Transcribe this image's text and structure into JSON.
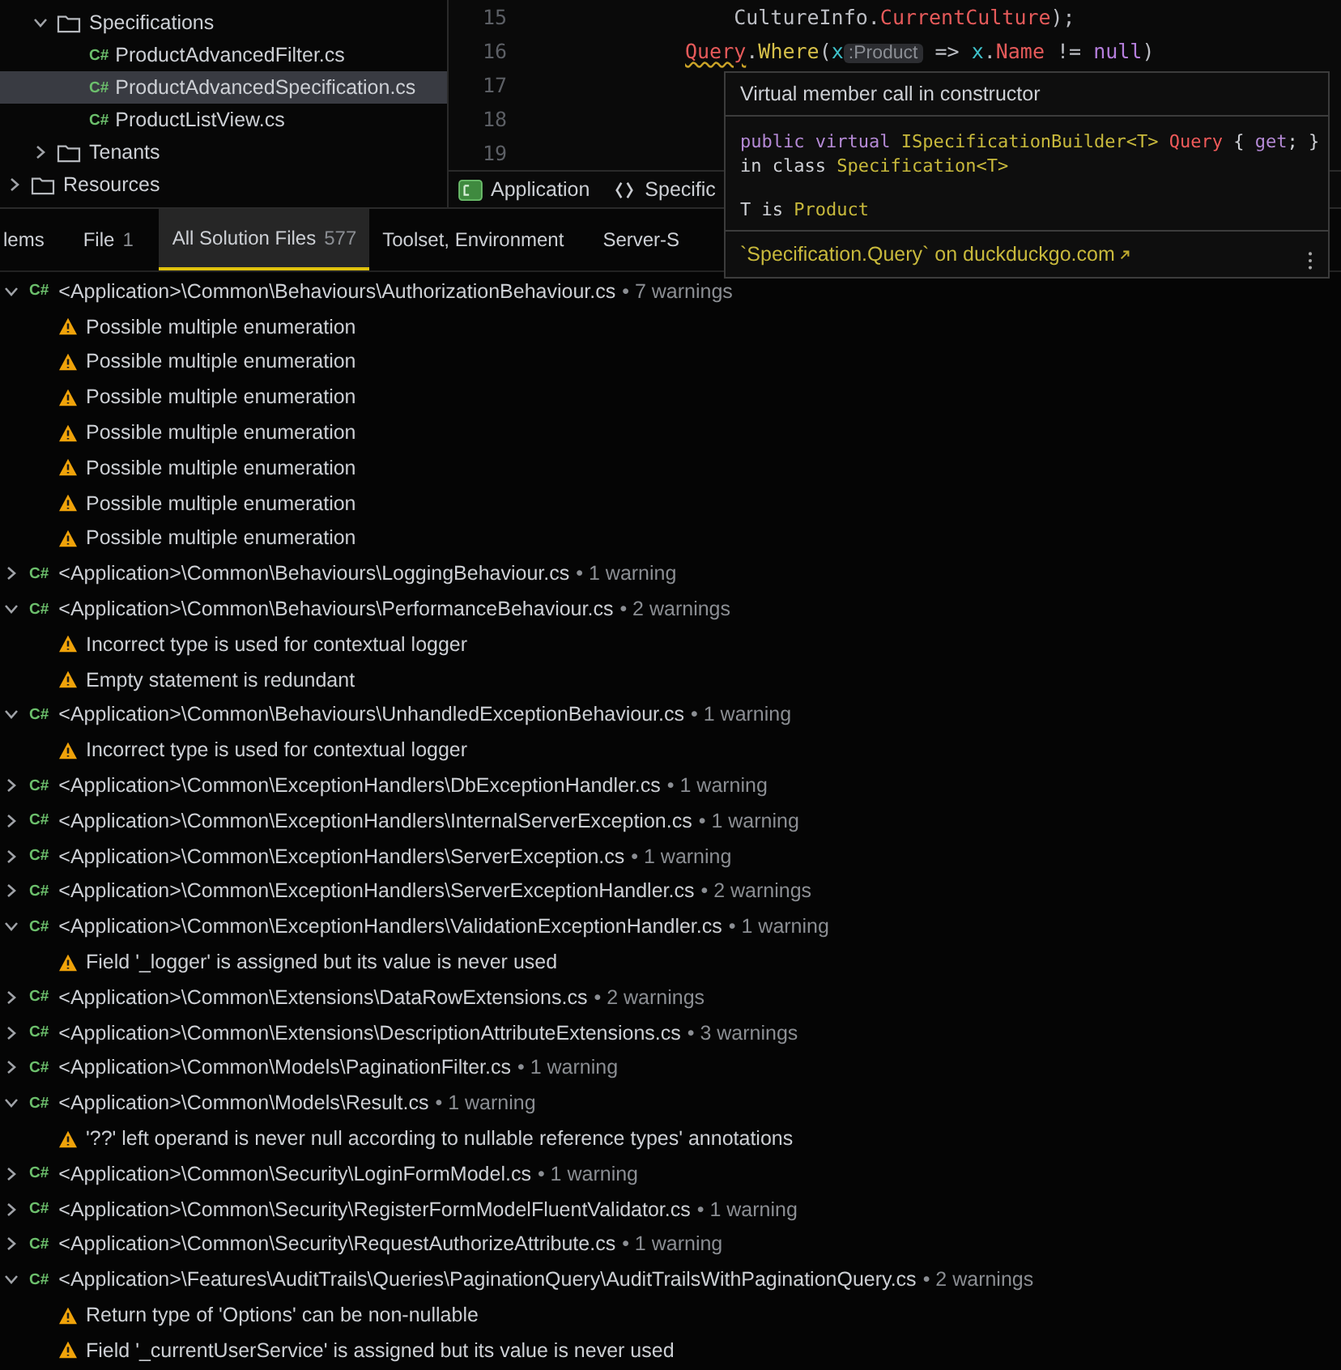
{
  "project_tree": {
    "items": [
      {
        "kind": "folder",
        "label": "Specifications",
        "expanded": true,
        "children": [
          {
            "kind": "file",
            "badge": "C#",
            "label": "ProductAdvancedFilter.cs",
            "selected": false
          },
          {
            "kind": "file",
            "badge": "C#",
            "label": "ProductAdvancedSpecification.cs",
            "selected": true
          },
          {
            "kind": "file",
            "badge": "C#",
            "label": "ProductListView.cs",
            "selected": false
          }
        ]
      },
      {
        "kind": "folder",
        "label": "Tenants",
        "expanded": false
      },
      {
        "kind": "folder",
        "label": "Resources",
        "expanded": false
      }
    ]
  },
  "editor": {
    "lines": [
      {
        "number": "15",
        "tokens": [
          {
            "kind": "plain",
            "text": "    CultureInfo."
          },
          {
            "kind": "member",
            "text": "CurrentCulture"
          },
          {
            "kind": "plain",
            "text": ");"
          }
        ]
      },
      {
        "number": "16",
        "tokens": [
          {
            "kind": "warn",
            "text": "Query"
          },
          {
            "kind": "plain",
            "text": "."
          },
          {
            "kind": "method",
            "text": "Where"
          },
          {
            "kind": "plain",
            "text": "("
          },
          {
            "kind": "param",
            "text": "x"
          },
          {
            "kind": "hint",
            "text": ":Product"
          },
          {
            "kind": "plain",
            "text": " => "
          },
          {
            "kind": "param",
            "text": "x"
          },
          {
            "kind": "plain",
            "text": "."
          },
          {
            "kind": "member",
            "text": "Name"
          },
          {
            "kind": "plain",
            "text": " != "
          },
          {
            "kind": "keyword",
            "text": "null"
          },
          {
            "kind": "plain",
            "text": ")"
          }
        ]
      },
      {
        "number": "17"
      },
      {
        "number": "18"
      },
      {
        "number": "19"
      }
    ],
    "breadcrumbs": [
      {
        "kind": "csharp",
        "label": "Application"
      },
      {
        "kind": "braces",
        "label": "Specific"
      }
    ]
  },
  "tooltip": {
    "title": "Virtual member call in constructor",
    "signature": [
      {
        "kind": "keyword",
        "text": "public virtual "
      },
      {
        "kind": "type",
        "text": "ISpecificationBuilder<T> "
      },
      {
        "kind": "member",
        "text": "Query"
      },
      {
        "kind": "plain",
        "text": " { "
      },
      {
        "kind": "keyword",
        "text": "get"
      },
      {
        "kind": "plain",
        "text": "; }"
      }
    ],
    "class_line": [
      {
        "kind": "plain",
        "text": "in class "
      },
      {
        "kind": "type",
        "text": "Specification<T>"
      }
    ],
    "type_line": [
      {
        "kind": "plain",
        "text": "T is "
      },
      {
        "kind": "type",
        "text": "Product"
      }
    ],
    "link": "`Specification.Query` on duckduckgo.com"
  },
  "problems_tabs": [
    {
      "label": "lems",
      "selected": false
    },
    {
      "label": "File",
      "count": "1",
      "selected": false
    },
    {
      "label": "All Solution Files",
      "count": "577",
      "selected": true
    },
    {
      "label": "Toolset, Environment",
      "selected": false
    },
    {
      "label": "Server-S",
      "selected": false
    }
  ],
  "files": [
    {
      "badge": "C#",
      "path": "<Application>\\Common\\Behaviours\\AuthorizationBehaviour.cs",
      "count": "• 7 warnings",
      "expanded": true,
      "warnings": [
        "Possible multiple enumeration",
        "Possible multiple enumeration",
        "Possible multiple enumeration",
        "Possible multiple enumeration",
        "Possible multiple enumeration",
        "Possible multiple enumeration",
        "Possible multiple enumeration"
      ]
    },
    {
      "badge": "C#",
      "path": "<Application>\\Common\\Behaviours\\LoggingBehaviour.cs",
      "count": "• 1 warning",
      "expanded": false
    },
    {
      "badge": "C#",
      "path": "<Application>\\Common\\Behaviours\\PerformanceBehaviour.cs",
      "count": "• 2 warnings",
      "expanded": true,
      "warnings": [
        "Incorrect type is used for contextual logger",
        "Empty statement is redundant"
      ]
    },
    {
      "badge": "C#",
      "path": "<Application>\\Common\\Behaviours\\UnhandledExceptionBehaviour.cs",
      "count": "• 1 warning",
      "expanded": true,
      "warnings": [
        "Incorrect type is used for contextual logger"
      ]
    },
    {
      "badge": "C#",
      "path": "<Application>\\Common\\ExceptionHandlers\\DbExceptionHandler.cs",
      "count": "• 1 warning",
      "expanded": false
    },
    {
      "badge": "C#",
      "path": "<Application>\\Common\\ExceptionHandlers\\InternalServerException.cs",
      "count": "• 1 warning",
      "expanded": false
    },
    {
      "badge": "C#",
      "path": "<Application>\\Common\\ExceptionHandlers\\ServerException.cs",
      "count": "• 1 warning",
      "expanded": false
    },
    {
      "badge": "C#",
      "path": "<Application>\\Common\\ExceptionHandlers\\ServerExceptionHandler.cs",
      "count": "• 2 warnings",
      "expanded": false
    },
    {
      "badge": "C#",
      "path": "<Application>\\Common\\ExceptionHandlers\\ValidationExceptionHandler.cs",
      "count": "• 1 warning",
      "expanded": true,
      "warnings": [
        "Field '_logger' is assigned but its value is never used"
      ]
    },
    {
      "badge": "C#",
      "path": "<Application>\\Common\\Extensions\\DataRowExtensions.cs",
      "count": "• 2 warnings",
      "expanded": false
    },
    {
      "badge": "C#",
      "path": "<Application>\\Common\\Extensions\\DescriptionAttributeExtensions.cs",
      "count": "• 3 warnings",
      "expanded": false
    },
    {
      "badge": "C#",
      "path": "<Application>\\Common\\Models\\PaginationFilter.cs",
      "count": "• 1 warning",
      "expanded": false
    },
    {
      "badge": "C#",
      "path": "<Application>\\Common\\Models\\Result.cs",
      "count": "• 1 warning",
      "expanded": true,
      "warnings": [
        "'??' left operand is never null according to nullable reference types' annotations"
      ]
    },
    {
      "badge": "C#",
      "path": "<Application>\\Common\\Security\\LoginFormModel.cs",
      "count": "• 1 warning",
      "expanded": false
    },
    {
      "badge": "C#",
      "path": "<Application>\\Common\\Security\\RegisterFormModelFluentValidator.cs",
      "count": "• 1 warning",
      "expanded": false
    },
    {
      "badge": "C#",
      "path": "<Application>\\Common\\Security\\RequestAuthorizeAttribute.cs",
      "count": "• 1 warning",
      "expanded": false
    },
    {
      "badge": "C#",
      "path": "<Application>\\Features\\AuditTrails\\Queries\\PaginationQuery\\AuditTrailsWithPaginationQuery.cs",
      "count": "• 2 warnings",
      "expanded": true,
      "warnings": [
        "Return type of 'Options' can be non-nullable",
        "Field '_currentUserService' is assigned but its value is never used"
      ]
    }
  ]
}
